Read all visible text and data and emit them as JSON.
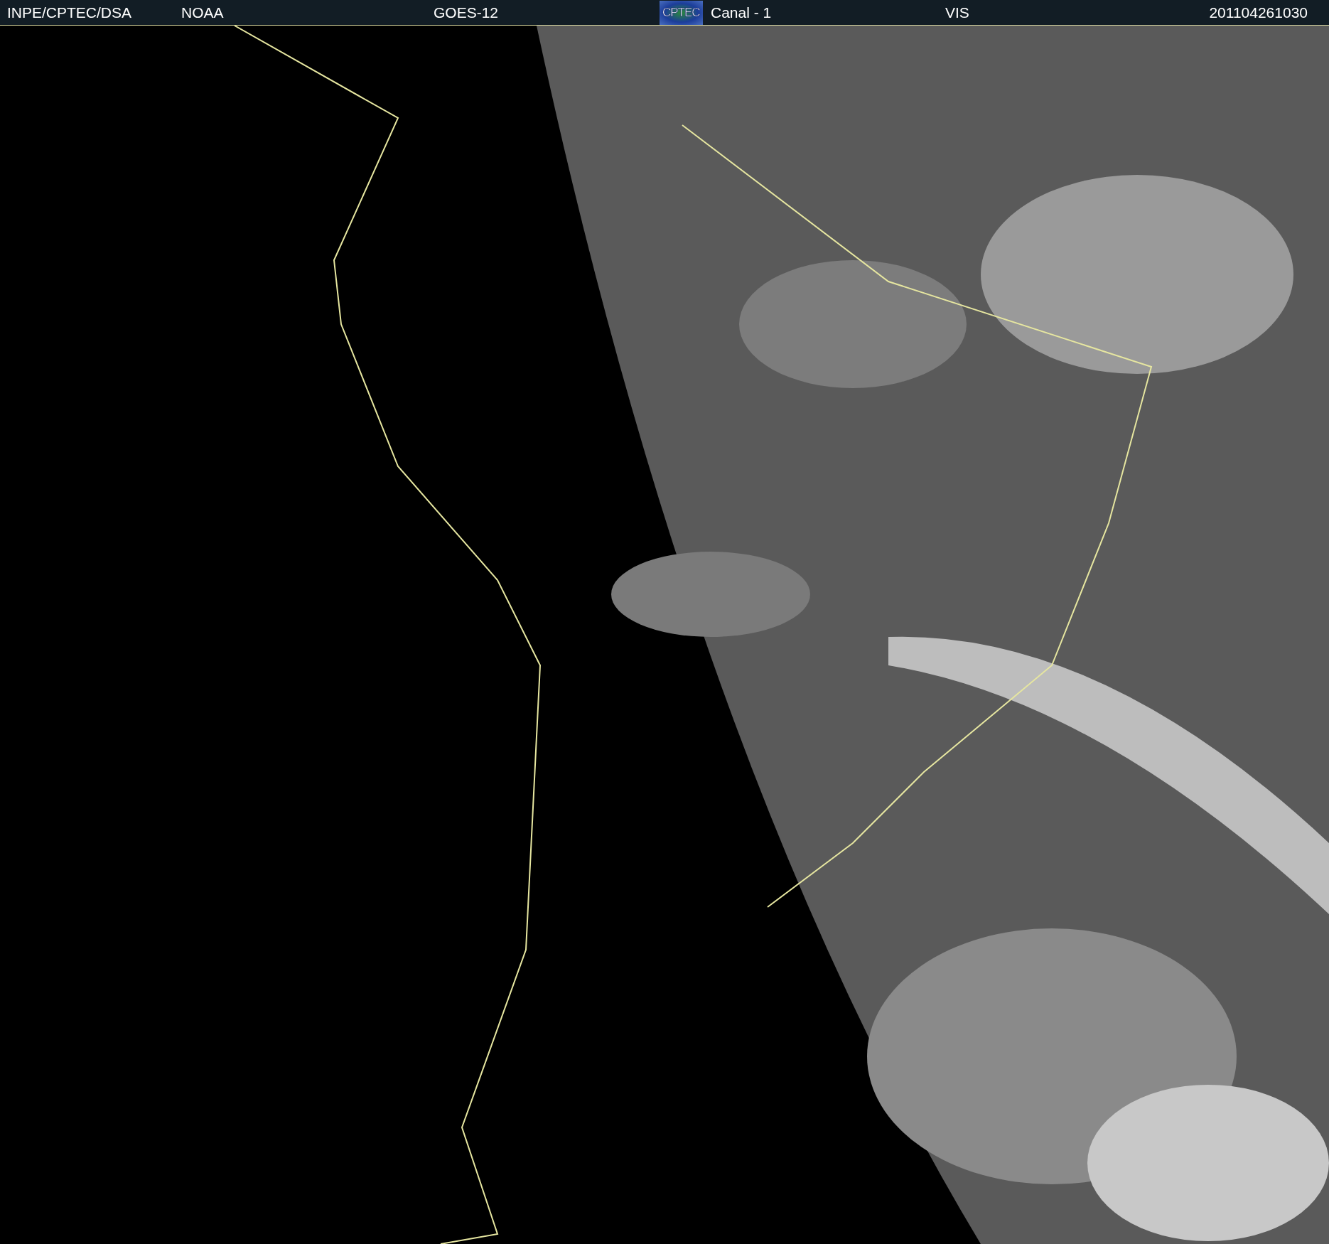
{
  "header": {
    "agency": "INPE/CPTEC/DSA",
    "source": "NOAA",
    "satellite": "GOES-12",
    "logo": "CPTEC",
    "channel": "Canal - 1",
    "band": "VIS",
    "timestamp": "201104261030"
  }
}
